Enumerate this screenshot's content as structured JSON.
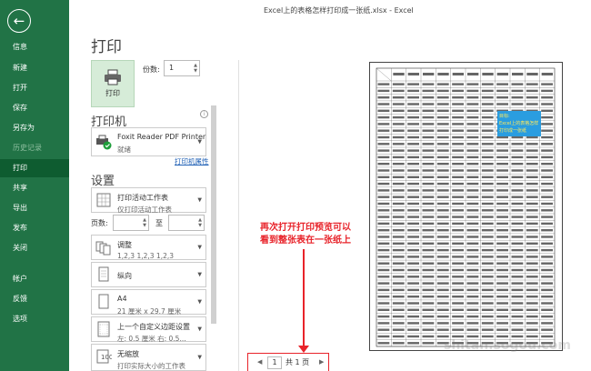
{
  "window": {
    "title": "Excel上的表格怎样打印成一张纸.xlsx  -  Excel"
  },
  "sidebar": {
    "items": [
      {
        "label": "信息",
        "state": "normal"
      },
      {
        "label": "新建",
        "state": "normal"
      },
      {
        "label": "打开",
        "state": "normal"
      },
      {
        "label": "保存",
        "state": "normal"
      },
      {
        "label": "另存为",
        "state": "normal"
      },
      {
        "label": "历史记录",
        "state": "disabled"
      },
      {
        "label": "打印",
        "state": "active"
      },
      {
        "label": "共享",
        "state": "normal"
      },
      {
        "label": "导出",
        "state": "normal"
      },
      {
        "label": "发布",
        "state": "normal"
      },
      {
        "label": "关闭",
        "state": "normal"
      },
      {
        "label": "帐户",
        "state": "normal"
      },
      {
        "label": "反馈",
        "state": "normal"
      },
      {
        "label": "选项",
        "state": "normal"
      }
    ]
  },
  "main": {
    "title": "打印",
    "print_button": "打印",
    "copies_label": "份数:",
    "copies_value": "1",
    "printer_heading": "打印机",
    "printer": {
      "name": "Foxit Reader PDF Printer",
      "status": "就绪"
    },
    "printer_props_link": "打印机属性",
    "settings_heading": "设置",
    "settings": [
      {
        "t1": "打印活动工作表",
        "t2": "仅打印活动工作表"
      },
      {
        "t1": "调整",
        "t2": "1,2,3    1,2,3    1,2,3"
      },
      {
        "t1": "纵向",
        "t2": ""
      },
      {
        "t1": "A4",
        "t2": "21 厘米 x 29.7 厘米"
      },
      {
        "t1": "上一个自定义边距设置",
        "t2": "左: 0.5 厘米    右: 0.5..."
      },
      {
        "t1": "无缩放",
        "t2": "打印实际大小的工作表"
      }
    ],
    "pages_label": "页数:",
    "to_label": "至"
  },
  "preview": {
    "annotation_line1": "再次打开打印预览可以",
    "annotation_line2": "看到整张表在一张纸上",
    "callout_text": "目标:\nExcel上的表格怎样打印成一张纸",
    "watermark": "shitan.sogou.com"
  },
  "pager": {
    "current": "1",
    "total_label": "共 1 页"
  },
  "colors": {
    "sidebar": "#217346",
    "accent_red": "#e8232a",
    "callout": "#2a9de0"
  }
}
